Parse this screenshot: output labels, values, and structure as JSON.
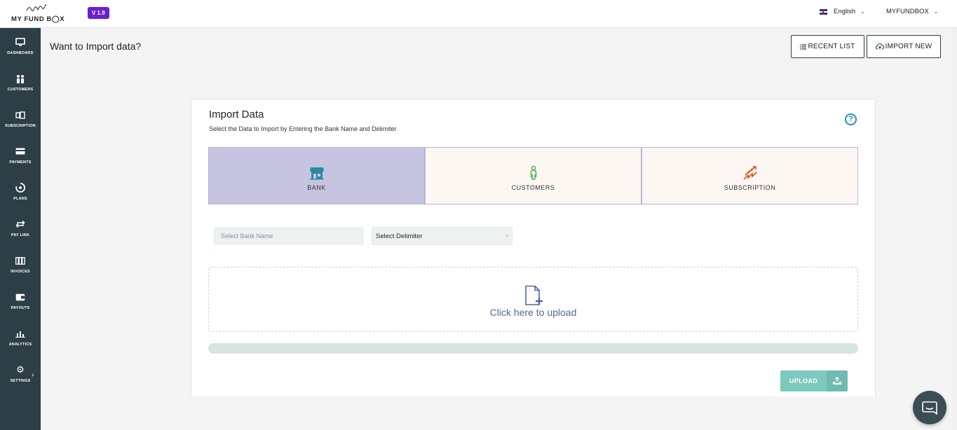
{
  "app": {
    "logo_text": "MY FUND B◯X",
    "version": "V 1.9",
    "language": "English",
    "account": "MYFUNDBOX"
  },
  "sidebar": {
    "items": [
      {
        "label": "DASHBOARD",
        "icon": "monitor-icon"
      },
      {
        "label": "CUSTOMERS",
        "icon": "users-icon"
      },
      {
        "label": "SUBSCRIPTION",
        "icon": "subscription-icon"
      },
      {
        "label": "PAYMENTS",
        "icon": "credit-card-icon"
      },
      {
        "label": "PLANS",
        "icon": "plans-icon"
      },
      {
        "label": "PAY LINK",
        "icon": "exchange-icon"
      },
      {
        "label": "INVOICES",
        "icon": "invoices-icon"
      },
      {
        "label": "PAYOUTS",
        "icon": "wallet-icon"
      },
      {
        "label": "ANALYTICS",
        "icon": "bar-chart-icon"
      },
      {
        "label": "SETTINGS",
        "icon": "gear-icon"
      }
    ]
  },
  "header": {
    "title": "Want to Import data?",
    "recent_list_label": "RECENT LIST",
    "import_new_label": "IMPORT NEW"
  },
  "card": {
    "title": "Import Data",
    "subtitle": "Select the Data to Import by Entering the Bank Name and Delimiter",
    "types": [
      {
        "label": "BANK",
        "icon": "bank-icon",
        "selected": true
      },
      {
        "label": "CUSTOMERS",
        "icon": "customer-icon",
        "selected": false
      },
      {
        "label": "SUBSCRIPTION",
        "icon": "stairs-icon",
        "selected": false
      }
    ],
    "bank_placeholder": "Select Bank Name",
    "delimiter_value": "Select Delimiter",
    "dropzone_text": "Click here to upload",
    "progress_fraction": 0,
    "upload_label": "UPLOAD"
  },
  "colors": {
    "sidebar": "#2c3e46",
    "selected_tile": "#c7c4e2",
    "accent_teal": "#7ec9bd",
    "version_badge": "#6a1fd1",
    "help_blue": "#2a8dbd"
  }
}
